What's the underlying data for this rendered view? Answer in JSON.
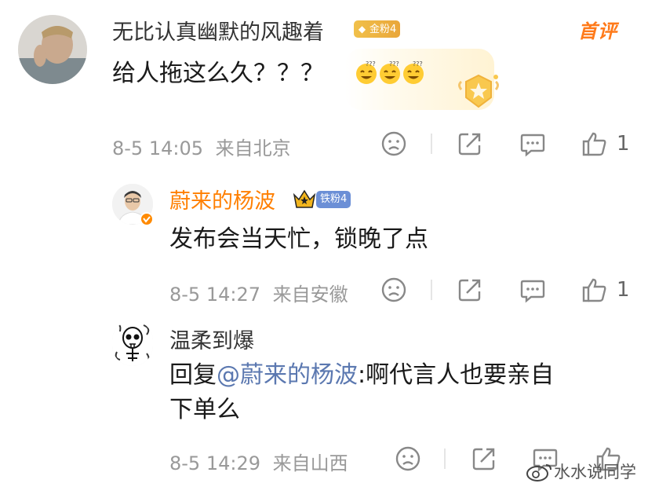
{
  "comments": [
    {
      "username": "无比认真幽默的风趣着",
      "fan_badge": "金粉4",
      "pinned_label": "首评",
      "text": "给人拖这么久？？？",
      "emojis": [
        "sweat-smile-emoji",
        "sweat-smile-emoji",
        "sweat-smile-emoji"
      ],
      "date": "8-5 14:05",
      "location": "来自北京",
      "like_count": "1"
    },
    {
      "username": "蔚来的杨波",
      "fan_badge": "铁粉4",
      "text": "发布会当天忙，锁晚了点",
      "date": "8-5 14:27",
      "location": "来自安徽",
      "like_count": "1"
    },
    {
      "username": "温柔到爆",
      "reply_prefix": "回复",
      "mention": "@蔚来的杨波",
      "text_line1": ":啊代言人也要亲自",
      "text_line2": "下单么",
      "date": "8-5 14:29",
      "location": "来自山西"
    }
  ],
  "watermark": "水水说同学",
  "colors": {
    "username_highlight": "#ff7f00",
    "meta_gray": "#999999",
    "mention_blue": "#5b78b0",
    "gold_badge": "#f1c04a",
    "iron_badge": "#6b8fd6"
  }
}
